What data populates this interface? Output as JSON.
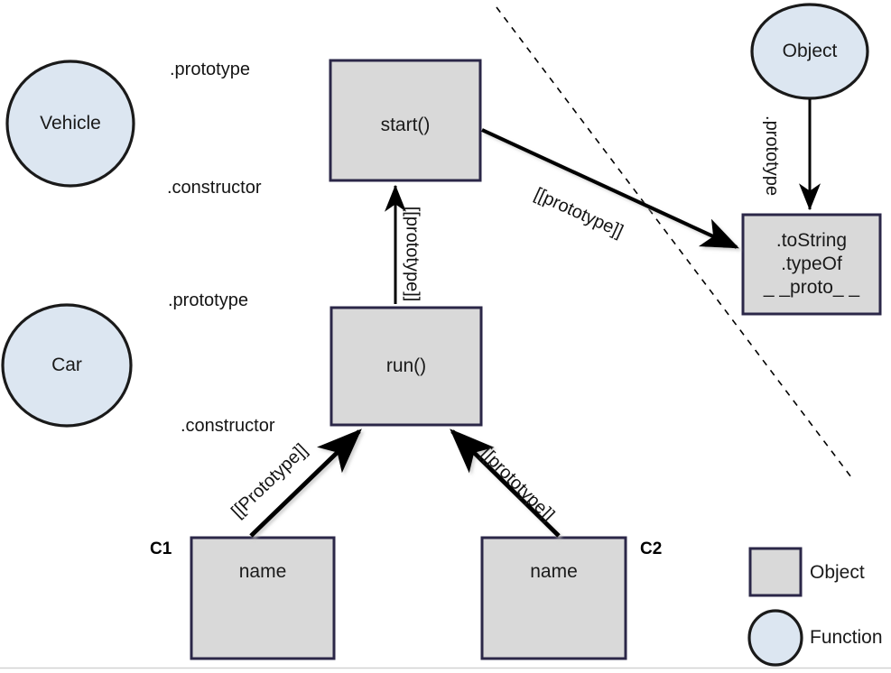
{
  "diagram": {
    "title": "JavaScript prototype chain diagram",
    "colors": {
      "function_fill": "#dce6f1",
      "function_stroke": "#1a1a1a",
      "object_fill": "#d9d9d9",
      "object_stroke": "#2b2748",
      "arrow": "#000000",
      "dashed_divider": "#000000",
      "background": "#ffffff",
      "bottom_rule": "#d2d2d2"
    },
    "nodes": [
      {
        "id": "vehicle",
        "shape": "circle",
        "kind": "Function",
        "label": "Vehicle"
      },
      {
        "id": "car",
        "shape": "circle",
        "kind": "Function",
        "label": "Car"
      },
      {
        "id": "object",
        "shape": "circle",
        "kind": "Function",
        "label": "Object"
      },
      {
        "id": "start",
        "shape": "rect",
        "kind": "Object",
        "label": "start()"
      },
      {
        "id": "run",
        "shape": "rect",
        "kind": "Object",
        "label": "run()"
      },
      {
        "id": "objectproto",
        "shape": "rect",
        "kind": "Object",
        "line1": ".toString",
        "line2": ".typeOf",
        "line3": "_ _proto_ _"
      },
      {
        "id": "c1",
        "shape": "rect",
        "kind": "Object",
        "label": "name",
        "corner_label": "C1"
      },
      {
        "id": "c2",
        "shape": "rect",
        "kind": "Object",
        "label": "name",
        "corner_label": "C2"
      }
    ],
    "edges": [
      {
        "id": "vehicle-prototype",
        "from": "vehicle",
        "to": "start",
        "label": ".prototype"
      },
      {
        "id": "start-constructor",
        "from": "start",
        "to": "vehicle",
        "label": ".constructor"
      },
      {
        "id": "car-prototype",
        "from": "car",
        "to": "run",
        "label": ".prototype"
      },
      {
        "id": "run-constructor",
        "from": "run",
        "to": "car",
        "label": ".constructor"
      },
      {
        "id": "run-to-start",
        "from": "run",
        "to": "start",
        "label": "[[prototype]]"
      },
      {
        "id": "start-to-objectproto",
        "from": "start",
        "to": "objectproto",
        "label": "[[prototype]]"
      },
      {
        "id": "object-prototype",
        "from": "object",
        "to": "objectproto",
        "label": ".prototype"
      },
      {
        "id": "c1-to-run",
        "from": "c1",
        "to": "run",
        "label": "[[Prototype]]"
      },
      {
        "id": "c2-to-run",
        "from": "c2",
        "to": "run",
        "label": "[[prototype]]"
      }
    ],
    "legend": {
      "items": [
        {
          "swatch": "rect",
          "label": "Object"
        },
        {
          "swatch": "circle",
          "label": "Function"
        }
      ]
    }
  }
}
